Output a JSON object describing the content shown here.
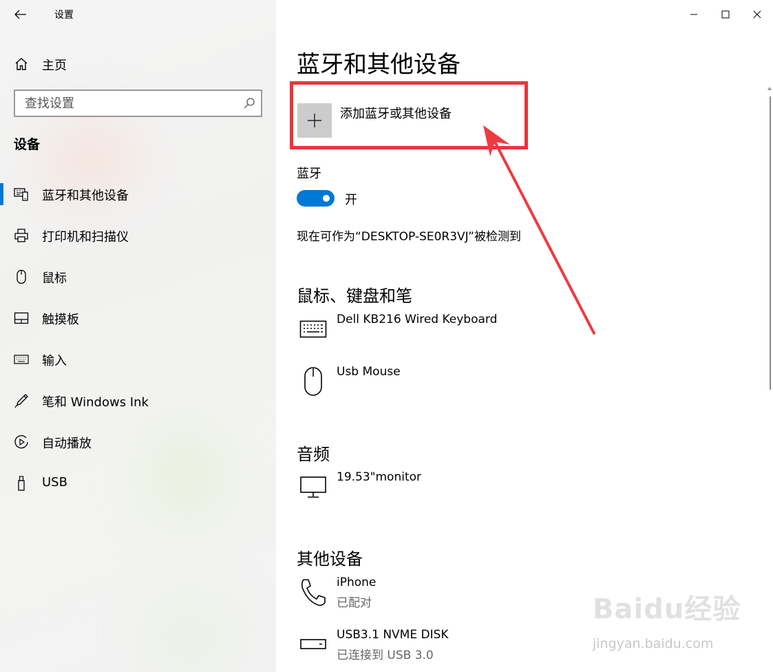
{
  "window": {
    "title": "设置",
    "controls": [
      "minimize-icon",
      "maximize-icon",
      "close-icon"
    ]
  },
  "sidebar": {
    "home_label": "主页",
    "search_placeholder": "查找设置",
    "section_title": "设备",
    "active_item": "蓝牙和其他设备",
    "accent_color": "#0078d7",
    "items": [
      {
        "label": "蓝牙和其他设备",
        "icon": "bluetooth-devices-icon"
      },
      {
        "label": "打印机和扫描仪",
        "icon": "printer-icon"
      },
      {
        "label": "鼠标",
        "icon": "mouse-icon"
      },
      {
        "label": "触摸板",
        "icon": "touchpad-icon"
      },
      {
        "label": "输入",
        "icon": "keyboard-icon"
      },
      {
        "label": "笔和 Windows Ink",
        "icon": "pen-icon"
      },
      {
        "label": "自动播放",
        "icon": "autoplay-icon"
      },
      {
        "label": "USB",
        "icon": "usb-icon"
      }
    ]
  },
  "main": {
    "page_title": "蓝牙和其他设备",
    "add_device_label": "添加蓝牙或其他设备",
    "bluetooth": {
      "label": "蓝牙",
      "state": "开",
      "on": true,
      "discoverable_text": "现在可作为“DESKTOP-SE0R3VJ”被检测到"
    },
    "groups": [
      {
        "title": "鼠标、键盘和笔",
        "devices": [
          {
            "name": "Dell KB216 Wired Keyboard",
            "status": "",
            "icon": "keyboard-device-icon"
          },
          {
            "name": "Usb Mouse",
            "status": "",
            "icon": "mouse-device-icon"
          }
        ]
      },
      {
        "title": "音频",
        "devices": [
          {
            "name": "19.53\"monitor",
            "status": "",
            "icon": "monitor-icon"
          }
        ]
      },
      {
        "title": "其他设备",
        "devices": [
          {
            "name": "iPhone",
            "status": "已配对",
            "icon": "phone-icon"
          },
          {
            "name": "USB3.1 NVME DISK",
            "status": "已连接到 USB 3.0",
            "icon": "drive-icon"
          }
        ]
      }
    ]
  },
  "annotation": {
    "highlight_color": "#e8363c"
  },
  "watermark": {
    "logo_text": "Baidu经验",
    "url": "jingyan.baidu.com"
  }
}
